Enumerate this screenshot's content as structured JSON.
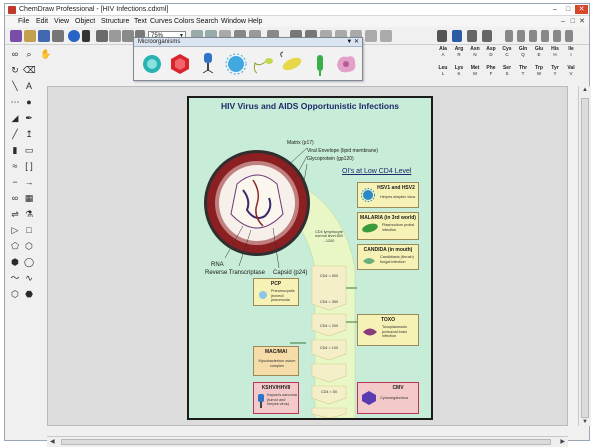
{
  "window": {
    "title": "ChemDraw Professional - [HIV Infections.cdxml]"
  },
  "menu": [
    "File",
    "Edit",
    "View",
    "Object",
    "Structure",
    "Text",
    "Curves",
    "Colors",
    "Search",
    "Window",
    "Help"
  ],
  "toolbar": {
    "zoom_value": "75%"
  },
  "palette": {
    "title": "Microorganisms"
  },
  "amino_acids": {
    "row1": [
      {
        "abbr": "Ala",
        "code": "A"
      },
      {
        "abbr": "Arg",
        "code": "R"
      },
      {
        "abbr": "Asn",
        "code": "N"
      },
      {
        "abbr": "Asp",
        "code": "D"
      },
      {
        "abbr": "Cys",
        "code": "C"
      },
      {
        "abbr": "Gln",
        "code": "Q"
      },
      {
        "abbr": "Glu",
        "code": "E"
      },
      {
        "abbr": "His",
        "code": "H"
      },
      {
        "abbr": "Ile",
        "code": "I"
      }
    ],
    "row2": [
      {
        "abbr": "Leu",
        "code": "L"
      },
      {
        "abbr": "Lys",
        "code": "K"
      },
      {
        "abbr": "Met",
        "code": "M"
      },
      {
        "abbr": "Phe",
        "code": "F"
      },
      {
        "abbr": "Ser",
        "code": "S"
      },
      {
        "abbr": "Thr",
        "code": "T"
      },
      {
        "abbr": "Trp",
        "code": "W"
      },
      {
        "abbr": "Tyr",
        "code": "Y"
      },
      {
        "abbr": "Val",
        "code": "V"
      }
    ]
  },
  "poster": {
    "title": "HIV Virus and AIDS Opportunistic Infections",
    "virus_labels": {
      "matrix": "Matrix (p17)",
      "envelope": "Viral Envelope (lipid membrane)",
      "glycoprotein": "Glycoprotein (gp120)",
      "rna": "RNA",
      "rt": "Reverse Transcriptase",
      "capsid": "Capsid (p24)"
    },
    "oi_title": "OI's at Low CD4 Level",
    "cd4_labels": [
      "CD4 lymphocyte normal level 800 - 1200",
      "CD4 < 500",
      "CD4 < 350",
      "CD4 < 200",
      "CD4 < 100",
      "CD4 < 50"
    ],
    "infections": {
      "hsv": {
        "title": "HSV1 and HSV2",
        "desc": "Herpes simplex virus"
      },
      "malaria": {
        "title": "MALARIA (in 3rd world)",
        "desc": "Plasmodium protist infection"
      },
      "candida": {
        "title": "CANDIDA (in mouth)",
        "desc": "Candidiasis (thrush) fungal infection"
      },
      "pcp": {
        "title": "PCP",
        "desc": "Pneumocystis jirovecii pneumonia"
      },
      "toxo": {
        "title": "TOXO",
        "desc": "Toxoplasmosis protozoal brain infection"
      },
      "mac": {
        "title": "MAC/MAI",
        "desc": "Mycobacterium avium complex"
      },
      "kshv": {
        "title": "KSHV/HHV8",
        "desc": "Kaposi's sarcoma (tumor and herpes virus)"
      },
      "cmv": {
        "title": "CMV",
        "desc": "Cytomegalovirus"
      }
    }
  }
}
